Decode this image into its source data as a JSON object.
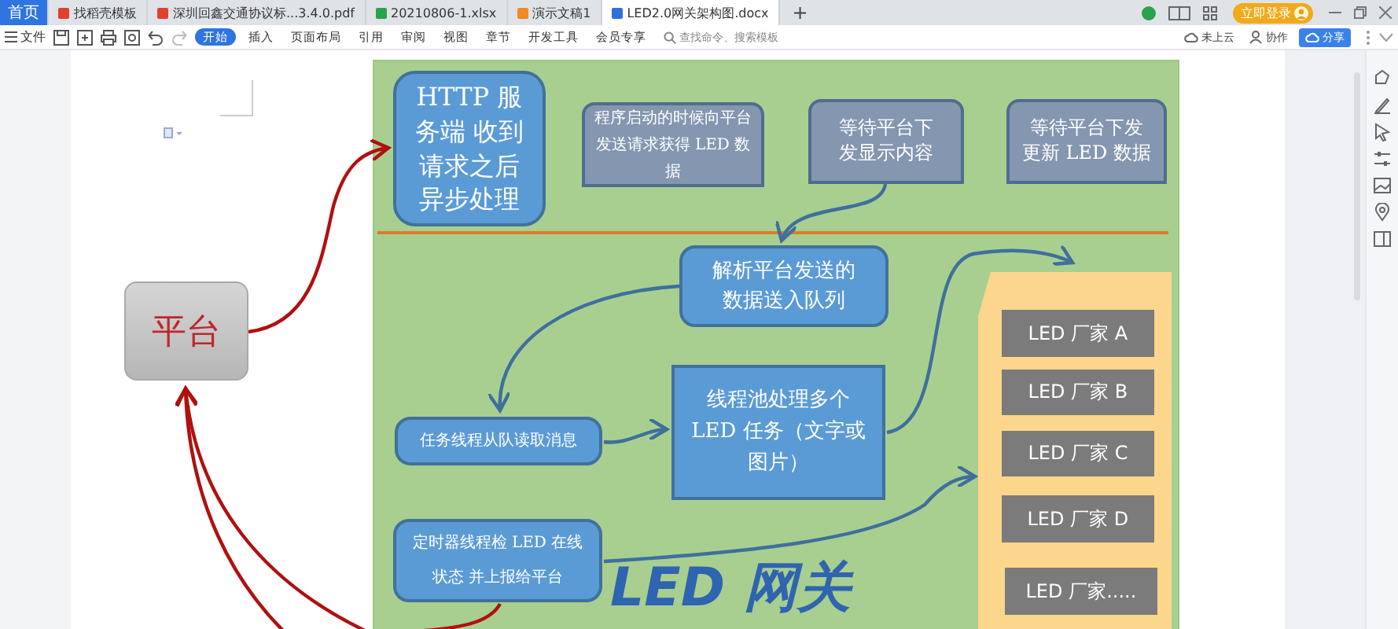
{
  "tabs": [
    {
      "kind": "home",
      "label": "首页",
      "selected": false
    },
    {
      "kind": "template",
      "label": "找稻壳模板",
      "selected": false
    },
    {
      "kind": "pdf",
      "label": "深圳回鑫交通协议标...3.4.0.pdf",
      "selected": false
    },
    {
      "kind": "sheet",
      "label": "20210806-1.xlsx",
      "selected": false
    },
    {
      "kind": "slides",
      "label": "演示文稿1",
      "selected": false
    },
    {
      "kind": "doc",
      "label": "LED2.0网关架构图.docx",
      "selected": true
    }
  ],
  "new_tab": "+",
  "login_button": "立即登录",
  "toolbar": {
    "file_menu": "文件",
    "ribbon_tabs": [
      {
        "label": "开始",
        "selected": true
      },
      {
        "label": "插入",
        "selected": false
      },
      {
        "label": "页面布局",
        "selected": false
      },
      {
        "label": "引用",
        "selected": false
      },
      {
        "label": "审阅",
        "selected": false
      },
      {
        "label": "视图",
        "selected": false
      },
      {
        "label": "章节",
        "selected": false
      },
      {
        "label": "开发工具",
        "selected": false
      },
      {
        "label": "会员专享",
        "selected": false
      }
    ],
    "search": {
      "placeholder": "查找命令、搜索模板"
    },
    "cloud": "未上云",
    "collaborate": "协作",
    "share": "分享"
  },
  "diagram": {
    "platform": "平台",
    "nodes": [
      {
        "kind": "rounded",
        "text": "HTTP 服务端 收到请求之后异步处理"
      },
      {
        "kind": "note",
        "text": "程序启动的时候向平台发送请求获得 LED 数据"
      },
      {
        "kind": "slate",
        "text": "等待平台下发显示内容"
      },
      {
        "kind": "slate",
        "text": "等待平台下发更新 LED 数据"
      },
      {
        "kind": "rounded",
        "text": "解析平台发送的数据送入队列"
      },
      {
        "kind": "rounded",
        "text": "任务线程从队读取消息"
      },
      {
        "kind": "square",
        "text": "线程池处理多个 LED 任务（文字或图片）"
      },
      {
        "kind": "rounded",
        "text": "定时器线程检 LED 在线状态 并上报给平台"
      }
    ],
    "vendors": [
      "LED 厂家 A",
      "LED 厂家 B",
      "LED 厂家 C",
      "LED 厂家 D",
      "LED 厂家....."
    ],
    "title": "LED 网关"
  }
}
